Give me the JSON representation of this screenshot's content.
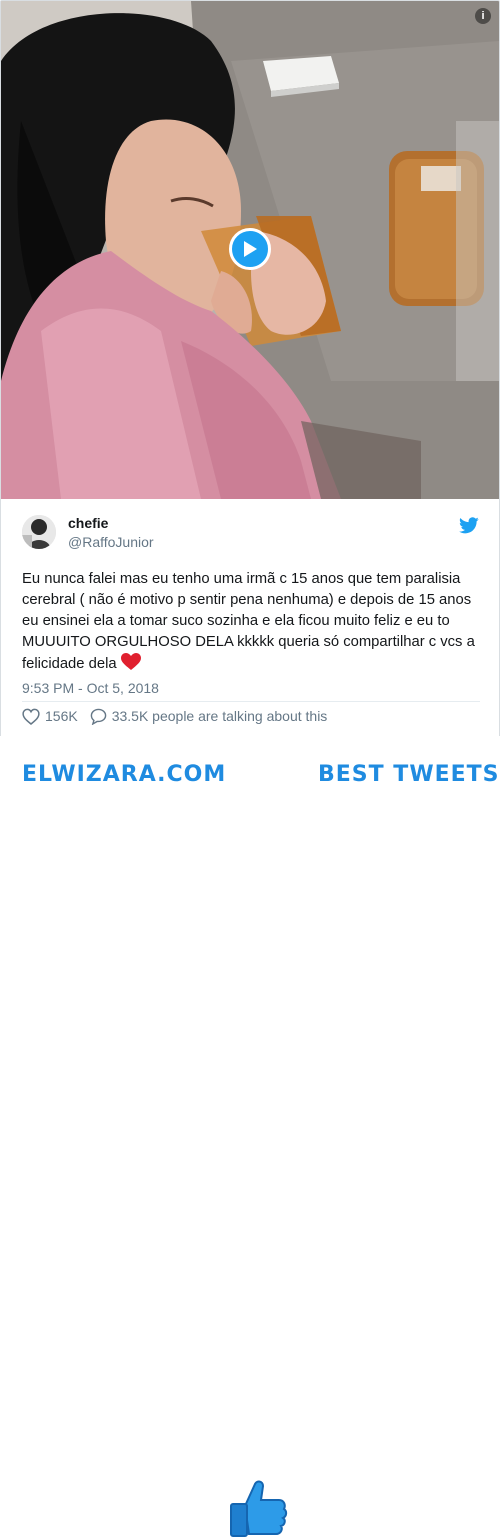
{
  "colors": {
    "accent": "#1da1f2",
    "brand": "#1f8be0",
    "text": "#14171a",
    "muted": "#657786"
  },
  "media": {
    "play_icon": "play-icon",
    "info_icon": "info-icon",
    "info_glyph": "i"
  },
  "tweet": {
    "display_name": "chefie",
    "handle": "@RaffoJunior",
    "text": "Eu nunca falei mas eu tenho uma irmã c 15 anos que tem paralisia cerebral ( não é motivo p sentir pena nenhuma) e depois de 15 anos eu ensinei ela a tomar suco sozinha e ela ficou muito feliz e eu to MUUUITO ORGULHOSO DELA kkkkk queria só compartilhar c vcs a felicidade dela",
    "emoji": "heart-icon",
    "timestamp": "9:53 PM - Oct 5, 2018",
    "likes": "156K",
    "conversation": "33.5K people are talking about this"
  },
  "footer": {
    "left_brand": "ELWIZARA.COM",
    "right_brand": "BEST TWEETS"
  }
}
